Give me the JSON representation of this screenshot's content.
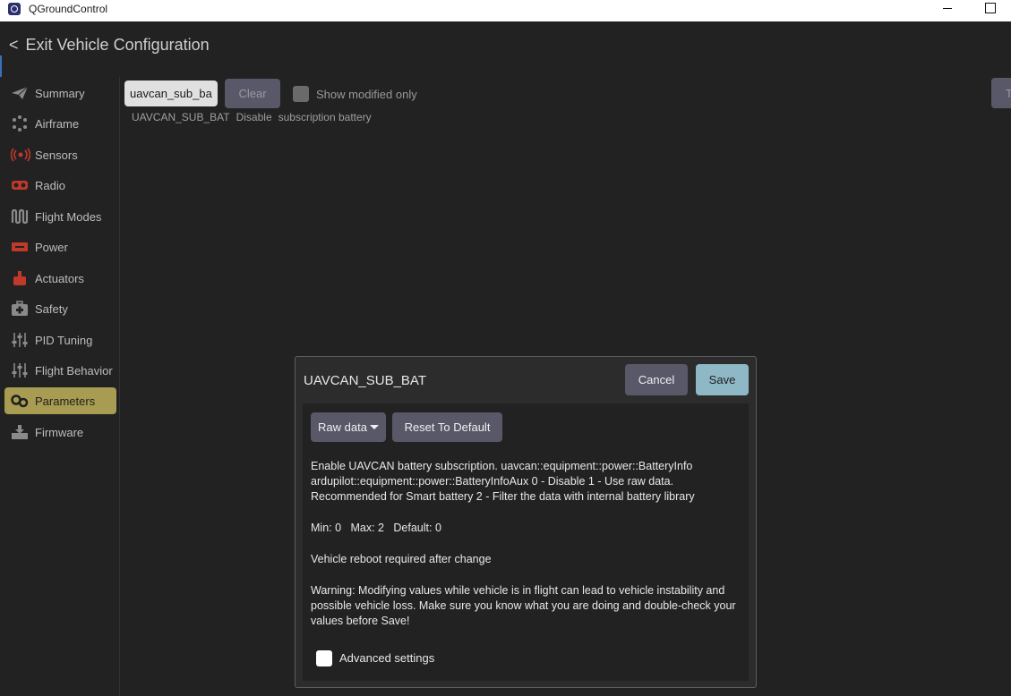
{
  "window": {
    "title": "QGroundControl"
  },
  "header": {
    "exit_chevron": "<",
    "exit_label": "Exit Vehicle Configuration"
  },
  "sidebar": {
    "items": [
      {
        "label": "Summary",
        "icon": "paper-plane-icon"
      },
      {
        "label": "Airframe",
        "icon": "airframe-dots-icon"
      },
      {
        "label": "Sensors",
        "icon": "sensors-broadcast-icon"
      },
      {
        "label": "Radio",
        "icon": "radio-icon"
      },
      {
        "label": "Flight Modes",
        "icon": "flight-modes-wave-icon"
      },
      {
        "label": "Power",
        "icon": "power-battery-icon"
      },
      {
        "label": "Actuators",
        "icon": "actuators-icon"
      },
      {
        "label": "Safety",
        "icon": "first-aid-kit-icon"
      },
      {
        "label": "PID Tuning",
        "icon": "sliders-icon"
      },
      {
        "label": "Flight Behavior",
        "icon": "sliders-icon"
      },
      {
        "label": "Parameters",
        "icon": "gears-icon"
      },
      {
        "label": "Firmware",
        "icon": "firmware-download-icon"
      }
    ],
    "active_item": "Parameters"
  },
  "filter": {
    "search_value": "uavcan_sub_bat",
    "clear_label": "Clear",
    "show_modified_label": "Show modified only",
    "tools_label": "T"
  },
  "param_row": {
    "name": "UAVCAN_SUB_BAT",
    "value": "Disable",
    "description": "subscription battery"
  },
  "dialog": {
    "title": "UAVCAN_SUB_BAT",
    "cancel_label": "Cancel",
    "save_label": "Save",
    "raw_data_label": "Raw data",
    "reset_label": "Reset To Default",
    "description_line1": "Enable UAVCAN battery subscription. uavcan::equipment::power::BatteryInfo",
    "description_line2": "ardupilot::equipment::power::BatteryInfoAux 0 - Disable 1 - Use raw data.",
    "description_line3": "Recommended for Smart battery 2 - Filter the data with internal battery library",
    "minmax": "Min: 0   Max: 2   Default: 0",
    "reboot": "Vehicle reboot required after change",
    "warning_line1": "Warning: Modifying values while vehicle is in flight can lead to vehicle instability and",
    "warning_line2": "possible vehicle loss. Make sure you know what you are doing and double-check your",
    "warning_line3": "values before Save!",
    "advanced_label": "Advanced settings"
  },
  "colors": {
    "accent_active": "#a79c51",
    "button_bg": "#585868",
    "save_bg": "#8fb8c6",
    "icon_red": "#c0392b"
  }
}
